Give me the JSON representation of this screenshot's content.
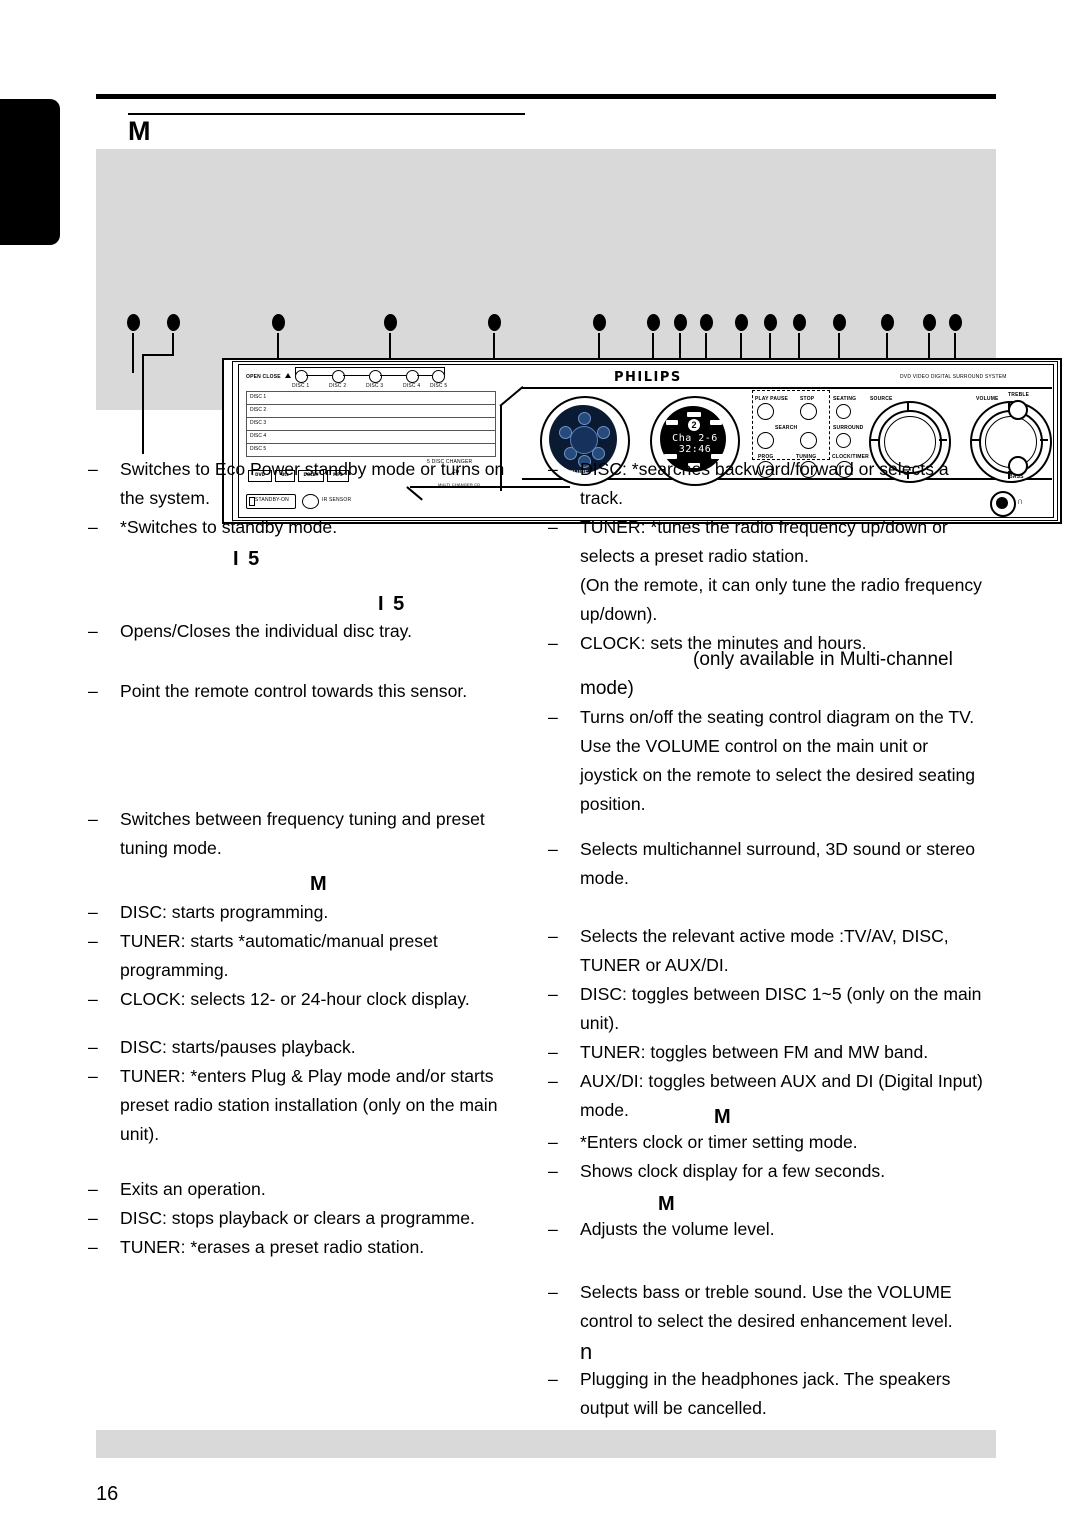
{
  "page": {
    "number": "16",
    "section_letter": "M"
  },
  "diagram": {
    "brand": "PHILIPS",
    "top_right_legend": "DVD VIDEO DIGITAL SURROUND SYSTEM",
    "changer_label": "5 DISC CHANGER",
    "open_close_label": "OPEN CLOSE",
    "disc_buttons": [
      "DISC 1",
      "DISC 2",
      "DISC 3",
      "DISC 4",
      "DISC 5"
    ],
    "trays": [
      "DISC 1",
      "DISC 2",
      "DISC 3",
      "DISC 4",
      "DISC 5"
    ],
    "standby_label": "STANDBY-ON",
    "ir_sensor_label": "IR SENSOR",
    "logos": [
      "DVD VIDEO",
      "dts DIGITAL OUT",
      "DOLBY DIGITAL",
      "MP3"
    ],
    "multi_disc_logo": "MULTI CHANGER CD",
    "display": {
      "line1": "Cha 2-6",
      "line2": "32:46",
      "badge": "2",
      "badge_suffix": "DVD"
    },
    "controls": {
      "play_pause": "PLAY PAUSE",
      "stop": "STOP",
      "search": "SEARCH",
      "seating": "SEATING",
      "surround": "SURROUND",
      "prog": "PROG",
      "tuning": "TUNING",
      "clock_timer": "CLOCK/TIMER",
      "source": "SOURCE",
      "volume": "VOLUME",
      "volume_dial": "VOLUME",
      "treble": "TREBLE",
      "bass": "BASS"
    }
  },
  "left_column": {
    "block1": [
      "Switches to Eco Power standby mode or turns on the system.",
      "*Switches to standby mode."
    ],
    "heading1": "I  5",
    "heading2": "I  5",
    "block2": [
      "Opens/Closes the individual disc tray."
    ],
    "block3": [
      "Point the remote control towards this sensor."
    ],
    "block4": [
      "Switches between frequency tuning and preset tuning mode."
    ],
    "heading3": "M",
    "block5": [
      "DISC: starts programming.",
      "TUNER: starts *automatic/manual preset programming.",
      "CLOCK: selects 12- or 24-hour clock display."
    ],
    "block6": [
      "DISC: starts/pauses playback.",
      "TUNER: *enters Plug & Play mode and/or starts preset radio station installation (only on the main unit)."
    ],
    "block7": [
      "Exits an operation.",
      "DISC: stops playback or clears a programme.",
      "TUNER: *erases a preset radio station."
    ]
  },
  "right_column": {
    "block1": [
      "DISC: *searches backward/forward or selects a track.",
      "TUNER: *tunes the radio frequency up/down or selects a preset radio station.",
      "CLOCK: sets the minutes and hours."
    ],
    "note1": "(On the remote, it can only tune the radio frequency up/down).",
    "heading1": "(only available in Multi-channel mode)",
    "block2": [
      "Turns on/off the seating control diagram on the TV.  Use the VOLUME control on the main unit or joystick on the remote to select the desired seating position."
    ],
    "block3": [
      "Selects multichannel surround, 3D sound or stereo mode."
    ],
    "block4": [
      "Selects the relevant active mode :TV/AV, DISC, TUNER or AUX/DI.",
      "DISC: toggles between DISC 1~5 (only on the main unit).",
      "TUNER: toggles between FM and MW band.",
      "AUX/DI: toggles between AUX and DI (Digital Input) mode."
    ],
    "heading2": "M",
    "block5": [
      "*Enters clock or timer setting mode.",
      "Shows clock display for a few seconds."
    ],
    "heading3": "M",
    "block6": [
      "Adjusts the volume level."
    ],
    "block7": [
      "Selects bass or treble sound.  Use the VOLUME control to select the desired enhancement level."
    ],
    "heading4": "n",
    "block8": [
      "Plugging in the headphones jack. The speakers output will be cancelled."
    ]
  },
  "list_marker": "–"
}
